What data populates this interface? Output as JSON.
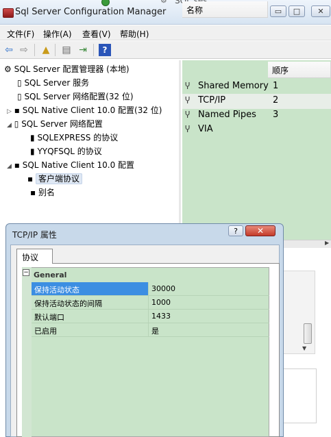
{
  "window": {
    "title": "Sql Server Configuration Manager",
    "bg_title_fragment": "SQL ses",
    "controls": {
      "minimize": "▭",
      "restore": "□",
      "close": "✕"
    }
  },
  "menu": [
    "文件(F)",
    "操作(A)",
    "查看(V)",
    "帮助(H)"
  ],
  "toolbar": {
    "icons": [
      "back-icon",
      "forward-icon",
      "up-folder-icon",
      "properties-icon",
      "export-icon",
      "help-icon"
    ],
    "help_glyph": "?"
  },
  "tree": {
    "root": "SQL Server 配置管理器 (本地)",
    "items": [
      {
        "label": "SQL Server 服务"
      },
      {
        "label": "SQL Server 网络配置(32 位)"
      },
      {
        "label": "SQL Native Client 10.0 配置(32 位)"
      },
      {
        "label": "SQL Server 网络配置"
      },
      {
        "label": "SQLEXPRESS 的协议"
      },
      {
        "label": "YYQFSQL 的协议"
      },
      {
        "label": "SQL Native Client 10.0 配置"
      },
      {
        "label": "客户端协议"
      },
      {
        "label": "别名"
      }
    ]
  },
  "list": {
    "columns": [
      "名称",
      "顺序"
    ],
    "rows": [
      {
        "name": "Shared Memory",
        "order": "1"
      },
      {
        "name": "TCP/IP",
        "order": "2"
      },
      {
        "name": "Named Pipes",
        "order": "3"
      },
      {
        "name": "VIA",
        "order": ""
      }
    ]
  },
  "dialog": {
    "title": "TCP/IP 属性",
    "help": "?",
    "close": "✕",
    "tab": "协议",
    "category": "General",
    "properties": [
      {
        "name": "保持活动状态",
        "value": "30000"
      },
      {
        "name": "保持活动状态的间隔",
        "value": "1000"
      },
      {
        "name": "默认端口",
        "value": "1433"
      },
      {
        "name": "已启用",
        "value": "是"
      }
    ]
  },
  "colors": {
    "list_bg": "#c9e4c9",
    "selection": "#3c8ee2",
    "close_red": "#c43b2a"
  }
}
